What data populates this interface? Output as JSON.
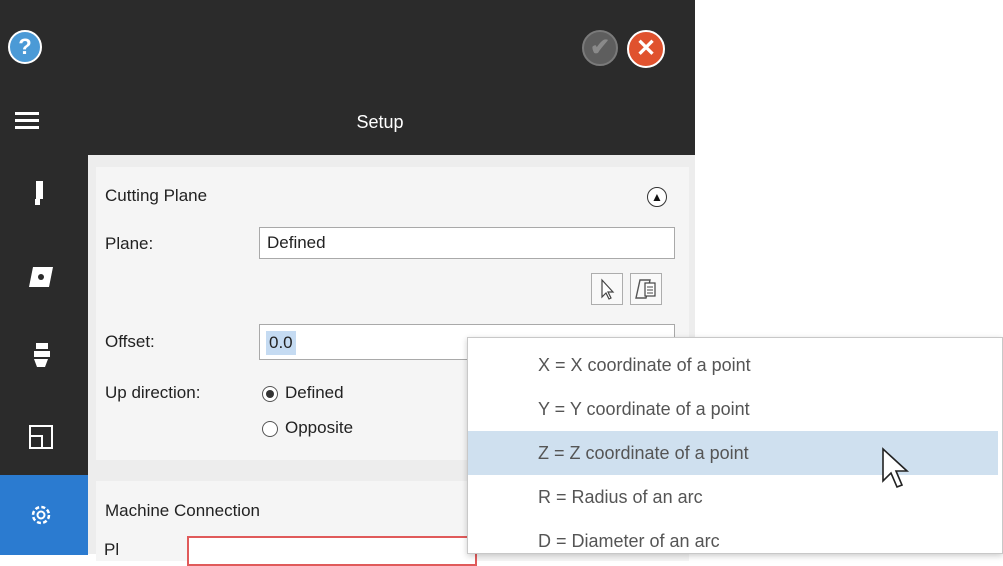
{
  "window": {
    "title": "Setup"
  },
  "icons": [
    "question-circle",
    "check-circle",
    "close-circle",
    "hamburger-menu",
    "tool",
    "insert",
    "holder",
    "layout",
    "gear",
    "arrow-cursor",
    "edit-table"
  ],
  "colors": {
    "accent": "#2b7bd0",
    "header_bg": "#2b2b2b",
    "cancel": "#e0522e",
    "help": "#4b9ad6",
    "highlight": "#cfe0ef",
    "error_border": "#e05a5a"
  },
  "sections": {
    "cutting_plane": {
      "title": "Cutting Plane",
      "plane_label": "Plane:",
      "plane_value": "Defined",
      "offset_label": "Offset:",
      "offset_value": "0.0",
      "up_direction_label": "Up direction:",
      "up_defined_label": "Defined",
      "up_opposite_label": "Opposite"
    },
    "machine_connection": {
      "title": "Machine Connection",
      "partial_label": "Pl"
    }
  },
  "popup": {
    "items": [
      {
        "label": "X  =  X coordinate of a point"
      },
      {
        "label": "Y  =  Y coordinate of a point"
      },
      {
        "label": "Z  =  Z coordinate of a point",
        "highlighted": true
      },
      {
        "label": "R  =  Radius of an arc"
      },
      {
        "label": "D  =  Diameter of an arc"
      }
    ]
  }
}
